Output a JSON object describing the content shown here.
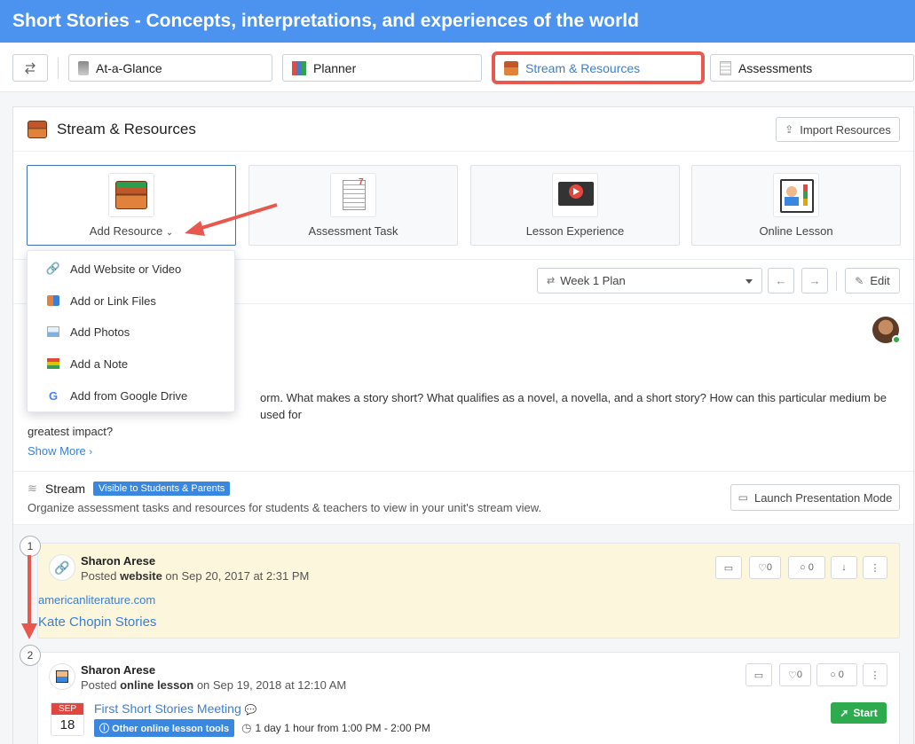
{
  "header": {
    "title": "Short Stories - Concepts, interpretations, and experiences of the world"
  },
  "tabs": [
    {
      "label": "At-a-Glance"
    },
    {
      "label": "Planner"
    },
    {
      "label": "Stream & Resources"
    },
    {
      "label": "Assessments"
    }
  ],
  "panel": {
    "title": "Stream & Resources",
    "import_label": "Import Resources"
  },
  "cards": [
    {
      "label": "Add Resource"
    },
    {
      "label": "Assessment Task"
    },
    {
      "label": "Lesson Experience"
    },
    {
      "label": "Online Lesson"
    }
  ],
  "dropdown": [
    {
      "label": "Add Website or Video"
    },
    {
      "label": "Add or Link Files"
    },
    {
      "label": "Add Photos"
    },
    {
      "label": "Add a Note"
    },
    {
      "label": "Add from Google Drive"
    }
  ],
  "toolbar": {
    "week": "Week 1 Plan",
    "edit": "Edit"
  },
  "description": {
    "text_visible_line1": "orm. What makes a story short? What qualifies as a novel, a novella, and a short story? How can this particular medium be used for",
    "text_visible_line2": "greatest impact?",
    "show_more": "Show More"
  },
  "stream": {
    "title": "Stream",
    "badge": "Visible to Students & Parents",
    "subtitle": "Organize assessment tasks and resources for students & teachers to view in your unit's stream view.",
    "present_label": "Launch Presentation Mode"
  },
  "posts": [
    {
      "number": "1",
      "author": "Sharon Arese",
      "posted_prefix": "Posted",
      "type": "website",
      "when": "on Sep 20, 2017 at 2:31 PM",
      "likes": "0",
      "comments": "0",
      "domain": "americanliterature.com",
      "title": "Kate Chopin Stories"
    },
    {
      "number": "2",
      "author": "Sharon Arese",
      "posted_prefix": "Posted",
      "type": "online lesson",
      "when": "on Sep 19, 2018 at 12:10 AM",
      "likes": "0",
      "comments": "0",
      "cal_month": "SEP",
      "cal_day": "18",
      "title": "First Short Stories Meeting",
      "tool_badge": "Other online lesson tools",
      "duration": "1 day 1 hour from 1:00 PM - 2:00 PM",
      "start": "Start"
    }
  ],
  "colors": {
    "accent": "#4c93ef",
    "link": "#3a7fd5",
    "highlight": "#e8584e",
    "post1_bg": "#fbf6dc",
    "start": "#2eaa4f"
  }
}
